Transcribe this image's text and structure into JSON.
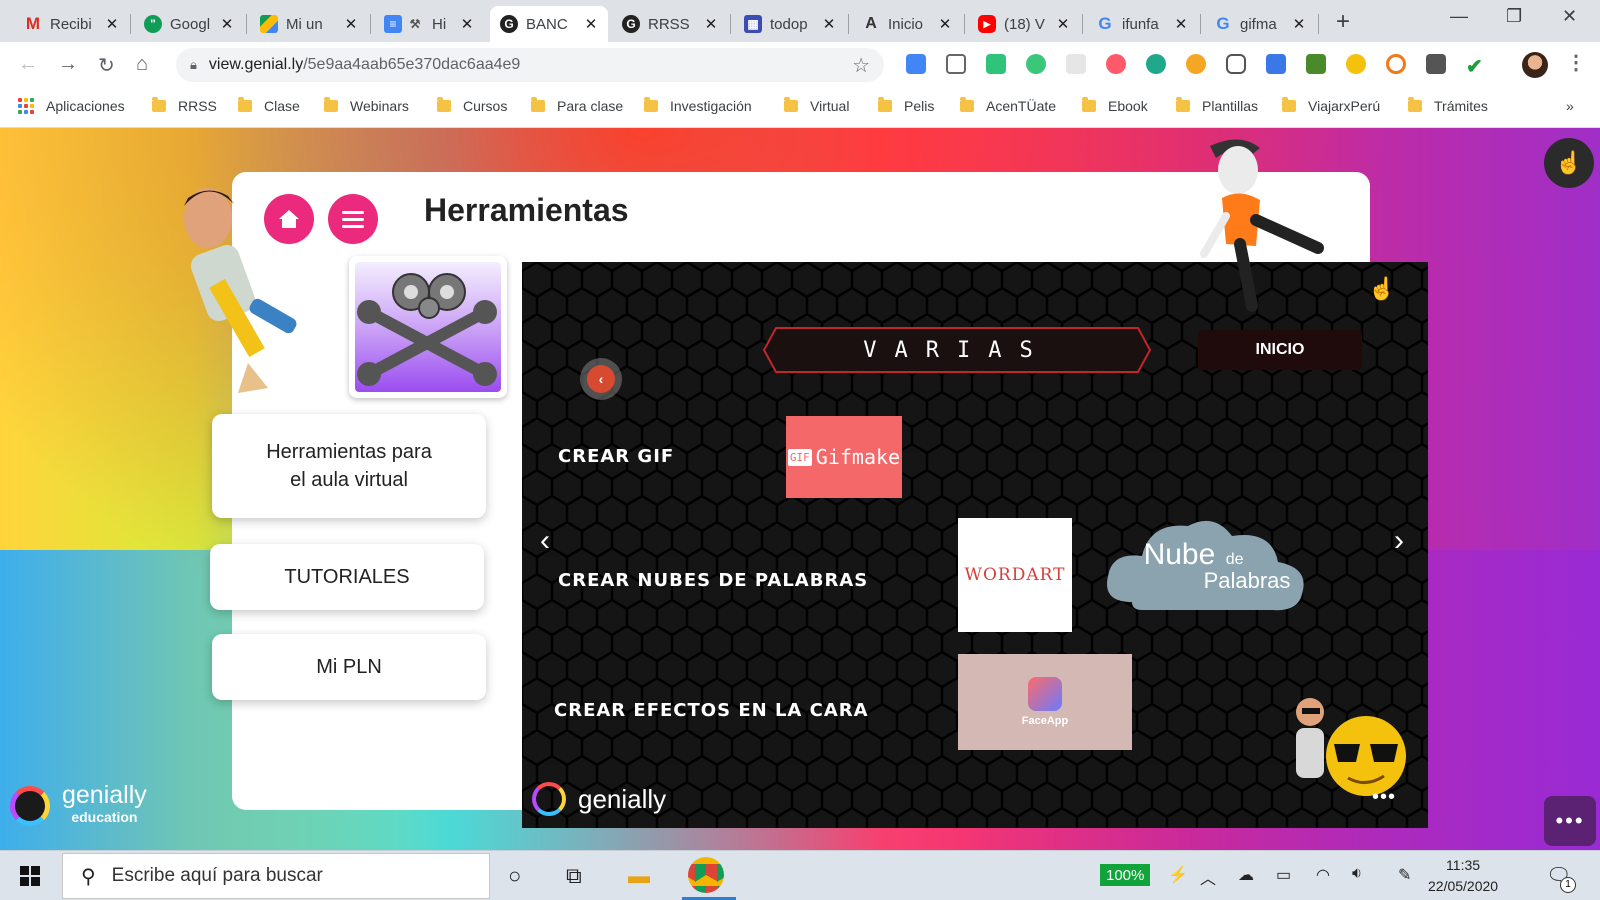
{
  "browser": {
    "tabs": [
      {
        "title": "Recibi",
        "favicon": "gmail-icon",
        "color": "#d93025",
        "active": false
      },
      {
        "title": "Googl",
        "favicon": "hangouts-icon",
        "color": "#0f9d58",
        "active": false
      },
      {
        "title": "Mi un",
        "favicon": "drive-icon",
        "color": "#fbbc04",
        "active": false
      },
      {
        "title": "Hi",
        "favicon": "docs-icon",
        "color": "#4285f4",
        "active": false
      },
      {
        "title": "BANC",
        "favicon": "genially-icon",
        "color": "#222222",
        "active": true
      },
      {
        "title": "RRSS",
        "favicon": "genially-icon",
        "color": "#222222",
        "active": false
      },
      {
        "title": "todop",
        "favicon": "calendar-icon",
        "color": "#3b4db2",
        "active": false
      },
      {
        "title": "Inicio",
        "favicon": "site-icon",
        "color": "#444444",
        "active": false
      },
      {
        "title": "(18) V",
        "favicon": "youtube-icon",
        "color": "#ff0000",
        "active": false
      },
      {
        "title": "ifunfa",
        "favicon": "google-icon",
        "color": "#4285f4",
        "active": false
      },
      {
        "title": "gifma",
        "favicon": "google-icon",
        "color": "#4285f4",
        "active": false
      }
    ],
    "new_tab": "+",
    "window_controls": {
      "minimize": "—",
      "restore": "❐",
      "close": "✕"
    },
    "url": {
      "host": "view.genial.ly",
      "path": "/5e9aa4aab65e370dac6aa4e9"
    },
    "bookmarks": [
      {
        "label": "Aplicaciones",
        "icon": "apps-grid-icon"
      },
      {
        "label": "RRSS",
        "icon": "folder-icon"
      },
      {
        "label": "Clase",
        "icon": "folder-icon"
      },
      {
        "label": "Webinars",
        "icon": "folder-icon"
      },
      {
        "label": "Cursos",
        "icon": "folder-icon"
      },
      {
        "label": "Para clase",
        "icon": "folder-icon"
      },
      {
        "label": "Investigación",
        "icon": "folder-icon"
      },
      {
        "label": "Virtual",
        "icon": "folder-icon"
      },
      {
        "label": "Pelis",
        "icon": "folder-icon"
      },
      {
        "label": "AcenTÜate",
        "icon": "folder-icon"
      },
      {
        "label": "Ebook",
        "icon": "folder-icon"
      },
      {
        "label": "Plantillas",
        "icon": "folder-icon"
      },
      {
        "label": "ViajarxPerú",
        "icon": "folder-icon"
      },
      {
        "label": "Trámites",
        "icon": "folder-icon"
      }
    ],
    "bookmarks_overflow": "»"
  },
  "page": {
    "title": "Herramientas",
    "menu": [
      {
        "label_line1": "Herramientas para",
        "label_line2": "el aula virtual"
      },
      {
        "label_line1": "TUTORIALES",
        "label_line2": ""
      },
      {
        "label_line1": "Mi PLN",
        "label_line2": ""
      }
    ],
    "presentation": {
      "banner": "VARIAS",
      "inicio": "INICIO",
      "rows": [
        {
          "label": "CREAR GIF",
          "app": "Gifmake"
        },
        {
          "label": "CREAR NUBES DE PALABRAS",
          "app": "WORDART"
        },
        {
          "label": "CREAR EFECTOS EN LA CARA",
          "app": "FaceApp"
        }
      ],
      "cloud": {
        "line1": "Nube",
        "line2": "de",
        "line3": "Palabras"
      },
      "footer_brand": "genially",
      "more": "•••"
    },
    "brand": {
      "name": "genially",
      "sub": "education"
    },
    "colors": {
      "accent": "#ec2a7d",
      "gifmake_bg": "#f4686a",
      "faceapp_bg": "#d4b8b4"
    }
  },
  "taskbar": {
    "search_placeholder": "Escribe aquí para buscar",
    "battery": "100%",
    "time": "11:35",
    "date": "22/05/2020",
    "notification_count": "1"
  }
}
